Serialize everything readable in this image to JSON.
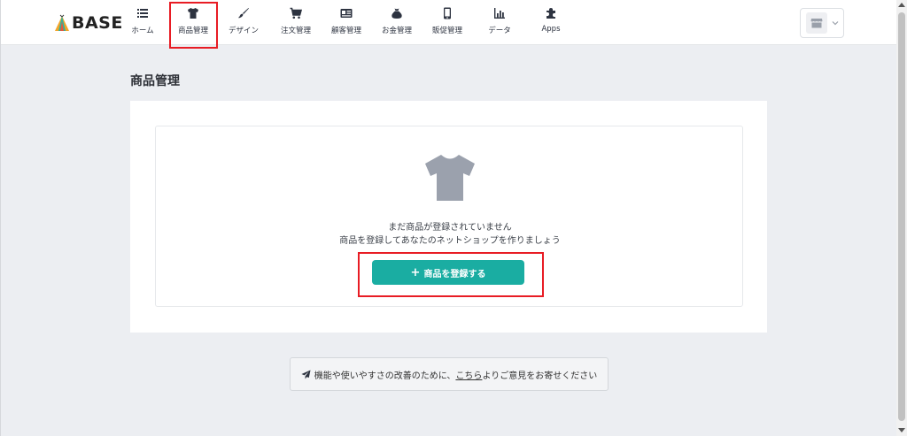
{
  "brand": {
    "name": "BASE"
  },
  "nav": [
    {
      "label": "ホーム",
      "icon": "list-icon"
    },
    {
      "label": "商品管理",
      "icon": "tshirt-icon",
      "active": true
    },
    {
      "label": "デザイン",
      "icon": "brush-icon"
    },
    {
      "label": "注文管理",
      "icon": "cart-icon"
    },
    {
      "label": "顧客管理",
      "icon": "id-card-icon"
    },
    {
      "label": "お金管理",
      "icon": "money-bag-icon"
    },
    {
      "label": "販促管理",
      "icon": "smartphone-icon"
    },
    {
      "label": "データ",
      "icon": "bar-chart-icon"
    },
    {
      "label": "Apps",
      "icon": "puzzle-icon"
    }
  ],
  "page": {
    "title": "商品管理",
    "empty_line1": "まだ商品が登録されていません",
    "empty_line2": "商品を登録してあなたのネットショップを作りましょう",
    "add_button": "商品を登録する",
    "add_button_icon": "plus-icon"
  },
  "feedback": {
    "prefix": "機能や使いやすさの改善のために、",
    "link": "こちら",
    "suffix": "よりご意見をお寄せください"
  },
  "colors": {
    "accent": "#1aada2",
    "highlight": "#e81c24",
    "background": "#eceef2"
  }
}
